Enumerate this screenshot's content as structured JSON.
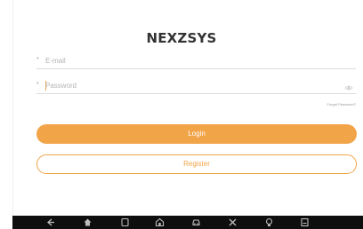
{
  "app": {
    "title": "NEXZSYS"
  },
  "form": {
    "email": {
      "required_mark": "*",
      "value": "",
      "placeholder": "E-mail"
    },
    "password": {
      "required_mark": "*",
      "value": "",
      "placeholder": "Password",
      "toggle_icon": "eye-icon"
    },
    "forget_label": "Forget Password?"
  },
  "buttons": {
    "login_label": "Login",
    "register_label": "Register"
  },
  "nav_bar": {
    "icons": [
      "back-icon",
      "home-icon",
      "recent-apps-icon",
      "house-icon",
      "car-icon",
      "tools-icon",
      "bulb-icon",
      "screenshot-icon"
    ]
  },
  "colors": {
    "accent": "#f2a449",
    "nav_bar_bg": "#0e0e0e",
    "title": "#333333",
    "placeholder": "#b4b4b4"
  }
}
